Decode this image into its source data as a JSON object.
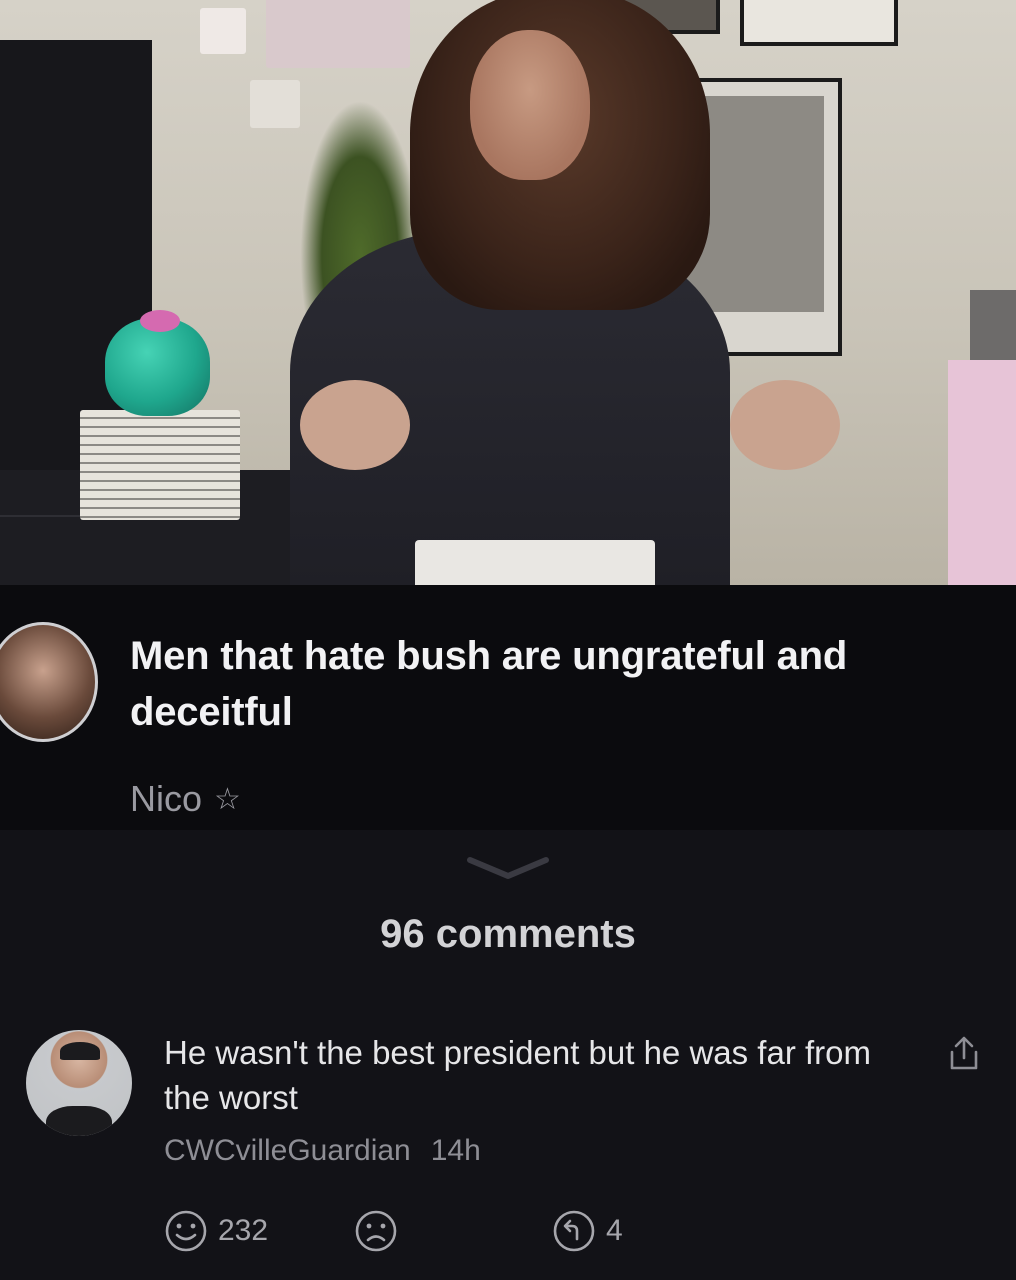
{
  "post": {
    "title": "Men that hate bush are ungrateful and deceitful",
    "author": "Nico",
    "author_badge": "star-icon"
  },
  "comments_header": {
    "count_label": "96 comments"
  },
  "comment": {
    "text": "He wasn't the best president but he was far from the worst",
    "username": "CWCvilleGuardian",
    "time": "14h",
    "likes": "232",
    "replies": "4"
  },
  "icons": {
    "expand": "chevron-down-icon",
    "share": "share-icon",
    "like": "smile-icon",
    "dislike": "frown-icon",
    "reply": "reply-icon"
  },
  "colors": {
    "background": "#121217",
    "header_bg": "#0b0b0e",
    "text_primary": "#f2f2f4",
    "text_muted": "#8e8e95"
  }
}
